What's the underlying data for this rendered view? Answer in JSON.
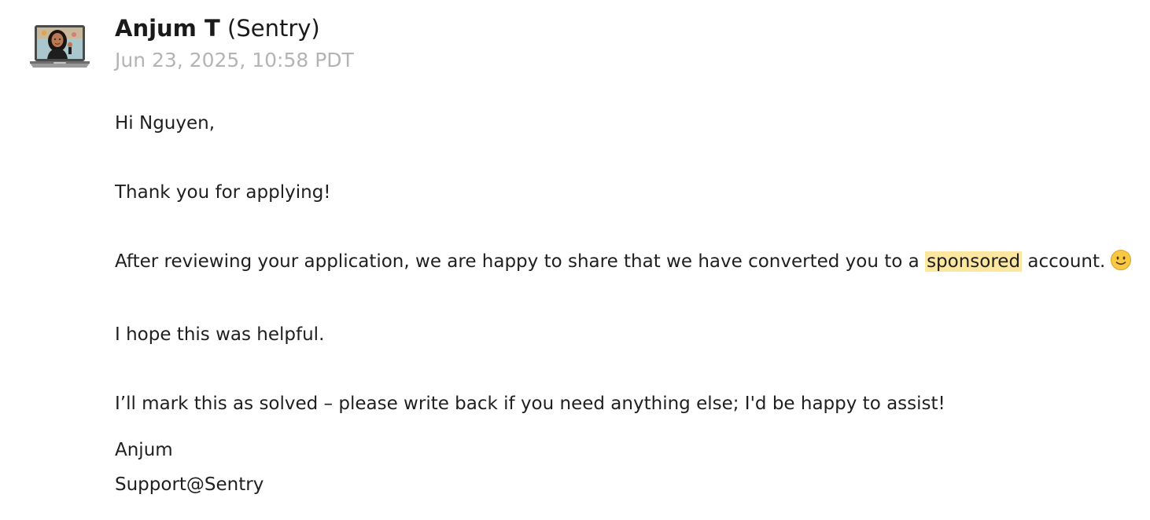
{
  "sender": {
    "name": "Anjum T",
    "org": "(Sentry)"
  },
  "timestamp": "Jun 23, 2025, 10:58 PDT",
  "avatar": {
    "icon": "laptop-memoji-avatar-icon"
  },
  "message": {
    "greeting": "Hi Nguyen,",
    "thanks": "Thank you for applying!",
    "converted_before": "After reviewing your application, we are happy to share that we have converted you to a",
    "converted_highlight": "sponsored",
    "converted_after": "account.",
    "smiley_icon": "slightly-smiling-face-icon",
    "helpful": "I hope this was helpful.",
    "solved": "I’ll mark this as solved – please write back if you need anything else; I'd be happy to assist!",
    "signature_name": "Anjum",
    "signature_team": "Support@Sentry"
  },
  "colors": {
    "highlight": "#fbe7a0",
    "timestamp": "#b4b4b4",
    "text": "#1f1f1f"
  }
}
